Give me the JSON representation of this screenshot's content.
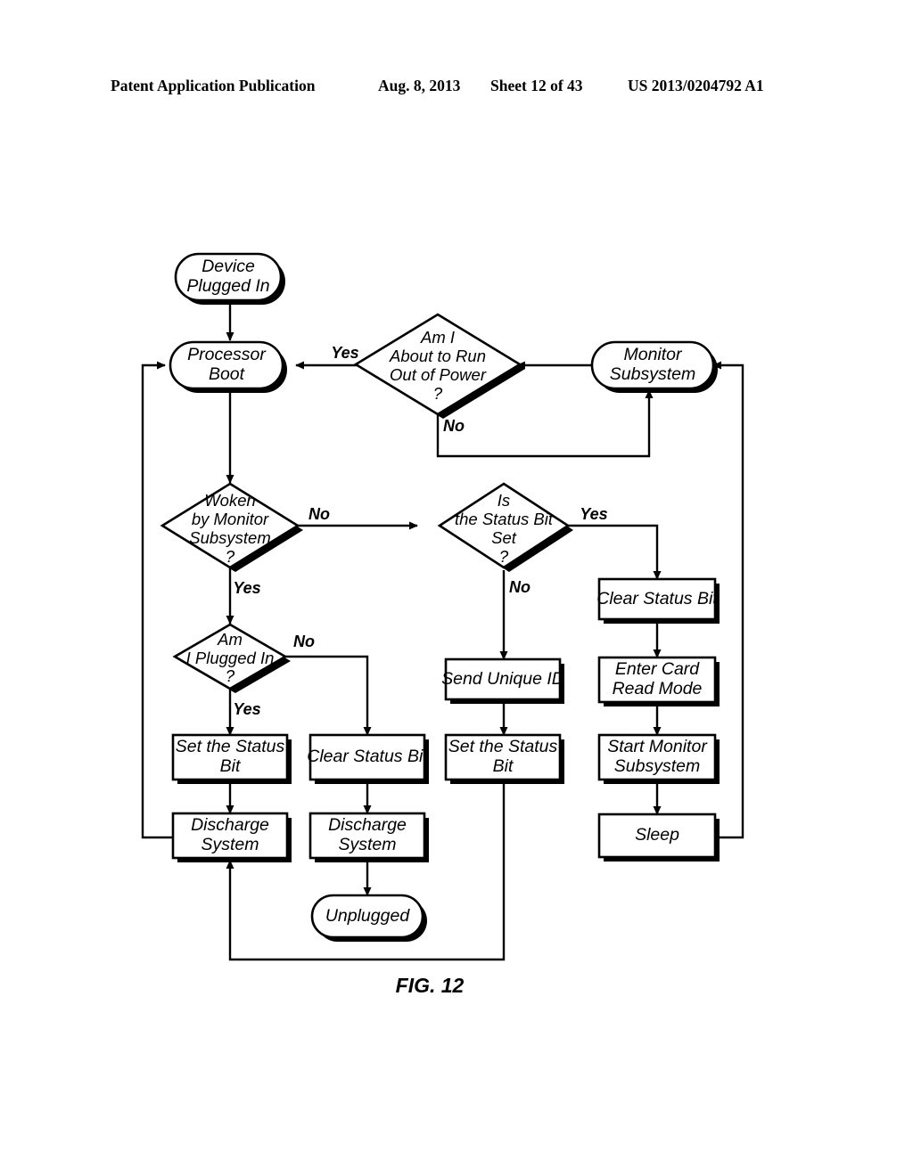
{
  "header": {
    "publication": "Patent Application Publication",
    "date": "Aug. 8, 2013",
    "sheet": "Sheet 12 of 43",
    "number": "US 2013/0204792 A1"
  },
  "figure": {
    "caption": "FIG. 12",
    "nodes": {
      "device_plugged_in": {
        "label_line1": "Device",
        "label_line2": "Plugged In",
        "shape": "terminator"
      },
      "processor_boot": {
        "label_line1": "Processor",
        "label_line2": "Boot",
        "shape": "terminator"
      },
      "am_i_about_to_run_out_of_power": {
        "label_line1": "Am I",
        "label_line2": "About to Run",
        "label_line3": "Out of Power",
        "label_line4": "?",
        "shape": "decision"
      },
      "monitor_subsystem": {
        "label_line1": "Monitor",
        "label_line2": "Subsystem",
        "shape": "terminator"
      },
      "woken_by_monitor_subsystem": {
        "label_line1": "Woken",
        "label_line2": "by Monitor",
        "label_line3": "Subsystem",
        "label_line4": "?",
        "shape": "decision"
      },
      "is_the_status_bit_set": {
        "label_line1": "Is",
        "label_line2": "the Status Bit",
        "label_line3": "Set",
        "label_line4": "?",
        "shape": "decision"
      },
      "clear_status_bit_right": {
        "label_line1": "Clear Status Bit",
        "shape": "process"
      },
      "am_i_plugged_in": {
        "label_line1": "Am",
        "label_line2": "I Plugged In",
        "label_line3": "?",
        "shape": "decision"
      },
      "send_unique_id": {
        "label_line1": "Send Unique ID",
        "shape": "process"
      },
      "enter_card_read_mode": {
        "label_line1": "Enter Card",
        "label_line2": "Read Mode",
        "shape": "process"
      },
      "set_the_status_bit_left": {
        "label_line1": "Set the Status",
        "label_line2": "Bit",
        "shape": "process"
      },
      "clear_status_bit_mid": {
        "label_line1": "Clear Status Bit",
        "shape": "process"
      },
      "set_the_status_bit_mid": {
        "label_line1": "Set the Status",
        "label_line2": "Bit",
        "shape": "process"
      },
      "start_monitor_subsystem": {
        "label_line1": "Start Monitor",
        "label_line2": "Subsystem",
        "shape": "process"
      },
      "discharge_system_left": {
        "label_line1": "Discharge",
        "label_line2": "System",
        "shape": "process"
      },
      "discharge_system_mid": {
        "label_line1": "Discharge",
        "label_line2": "System",
        "shape": "process"
      },
      "sleep": {
        "label_line1": "Sleep",
        "shape": "process"
      },
      "unplugged": {
        "label_line1": "Unplugged",
        "shape": "terminator"
      }
    },
    "edge_labels": {
      "power_yes": "Yes",
      "power_no": "No",
      "woken_no": "No",
      "woken_yes": "Yes",
      "status_set_yes": "Yes",
      "status_set_no": "No",
      "plugged_no": "No",
      "plugged_yes": "Yes"
    },
    "colors": {
      "ink": "#000000",
      "paper": "#ffffff"
    }
  }
}
